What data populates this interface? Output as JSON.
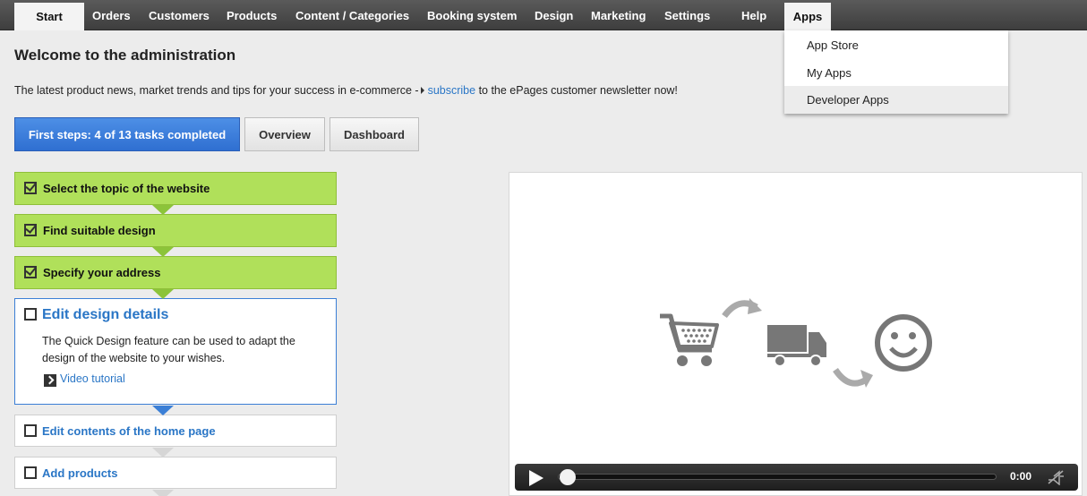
{
  "nav": {
    "items": [
      {
        "label": "Start"
      },
      {
        "label": "Orders"
      },
      {
        "label": "Customers"
      },
      {
        "label": "Products"
      },
      {
        "label": "Content / Categories"
      },
      {
        "label": "Booking system"
      },
      {
        "label": "Design"
      },
      {
        "label": "Marketing"
      },
      {
        "label": "Settings"
      },
      {
        "label": "Help"
      },
      {
        "label": "Apps"
      }
    ]
  },
  "apps_menu": {
    "items": [
      {
        "label": "App Store"
      },
      {
        "label": "My Apps"
      },
      {
        "label": "Developer Apps"
      }
    ]
  },
  "main": {
    "title": "Welcome to the administration",
    "news_prefix": "The latest product news, market trends and tips for your success in e-commerce -",
    "news_link": "subscribe",
    "news_suffix": "to the ePages customer newsletter now!"
  },
  "tabs": [
    {
      "label": "First steps: 4 of 13 tasks completed"
    },
    {
      "label": "Overview"
    },
    {
      "label": "Dashboard"
    }
  ],
  "steps": {
    "done": [
      {
        "label": "Select the topic of the website"
      },
      {
        "label": "Find suitable design"
      },
      {
        "label": "Specify your address"
      }
    ],
    "current": {
      "title": "Edit design details",
      "description": "The Quick Design feature can be used to adapt the design of the website to your wishes.",
      "link": "Video tutorial"
    },
    "todo": [
      {
        "label": "Edit contents of the home page"
      },
      {
        "label": "Add products"
      }
    ]
  },
  "video": {
    "time": "0:00",
    "progress": 0
  },
  "colors": {
    "accent_blue": "#2a76c6",
    "step_done_green": "#b0e05a",
    "tab_primary": "#3a7bd9"
  }
}
